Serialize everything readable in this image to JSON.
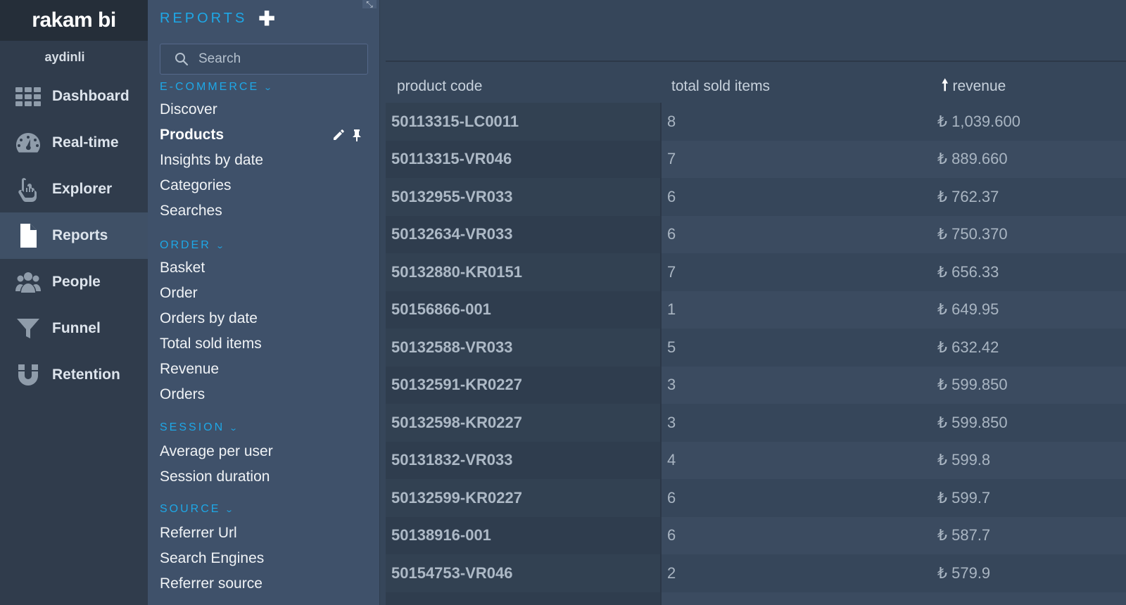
{
  "app": {
    "logo": "rakam bi",
    "user": "aydinli"
  },
  "nav": [
    {
      "label": "Dashboard",
      "icon": "grid-icon"
    },
    {
      "label": "Real-time",
      "icon": "speedometer-icon"
    },
    {
      "label": "Explorer",
      "icon": "pointer-hand-icon"
    },
    {
      "label": "Reports",
      "icon": "document-icon",
      "active": true
    },
    {
      "label": "People",
      "icon": "people-icon"
    },
    {
      "label": "Funnel",
      "icon": "funnel-icon"
    },
    {
      "label": "Retention",
      "icon": "magnet-icon"
    }
  ],
  "panel": {
    "title": "REPORTS",
    "add_symbol": "✚",
    "collapse_symbol": "⤡",
    "search_placeholder": "Search",
    "groups": [
      {
        "title": "E-COMMERCE",
        "items": [
          "Discover",
          "Products",
          "Insights by date",
          "Categories",
          "Searches"
        ],
        "active_item": "Products"
      },
      {
        "title": "ORDER",
        "items": [
          "Basket",
          "Order",
          "Orders by date",
          "Total sold items",
          "Revenue",
          "Orders"
        ]
      },
      {
        "title": "SESSION",
        "items": [
          "Average per user",
          "Session duration"
        ]
      },
      {
        "title": "SOURCE",
        "items": [
          "Referrer Url",
          "Search Engines",
          "Referrer source"
        ]
      }
    ]
  },
  "table": {
    "headers": {
      "product_code": "product code",
      "total_sold_items": "total sold items",
      "revenue": "revenue",
      "sort_arrow": "🠕"
    },
    "rows": [
      {
        "code": "50113315-LC0011",
        "sold": "8",
        "revenue": "₺ 1,039.600"
      },
      {
        "code": "50113315-VR046",
        "sold": "7",
        "revenue": "₺ 889.660"
      },
      {
        "code": "50132955-VR033",
        "sold": "6",
        "revenue": "₺ 762.37"
      },
      {
        "code": "50132634-VR033",
        "sold": "6",
        "revenue": "₺ 750.370"
      },
      {
        "code": "50132880-KR0151",
        "sold": "7",
        "revenue": "₺ 656.33"
      },
      {
        "code": "50156866-001",
        "sold": "1",
        "revenue": "₺ 649.95"
      },
      {
        "code": "50132588-VR033",
        "sold": "5",
        "revenue": "₺ 632.42"
      },
      {
        "code": "50132591-KR0227",
        "sold": "3",
        "revenue": "₺ 599.850"
      },
      {
        "code": "50132598-KR0227",
        "sold": "3",
        "revenue": "₺ 599.850"
      },
      {
        "code": "50131832-VR033",
        "sold": "4",
        "revenue": "₺ 599.8"
      },
      {
        "code": "50132599-KR0227",
        "sold": "6",
        "revenue": "₺ 599.7"
      },
      {
        "code": "50138916-001",
        "sold": "6",
        "revenue": "₺ 587.7"
      },
      {
        "code": "50154753-VR046",
        "sold": "2",
        "revenue": "₺ 579.9"
      }
    ]
  },
  "colors": {
    "accent": "#1ea8e7",
    "nav_bg": "#303c4c",
    "panel_bg": "#3f516a",
    "main_bg": "#36465a"
  }
}
